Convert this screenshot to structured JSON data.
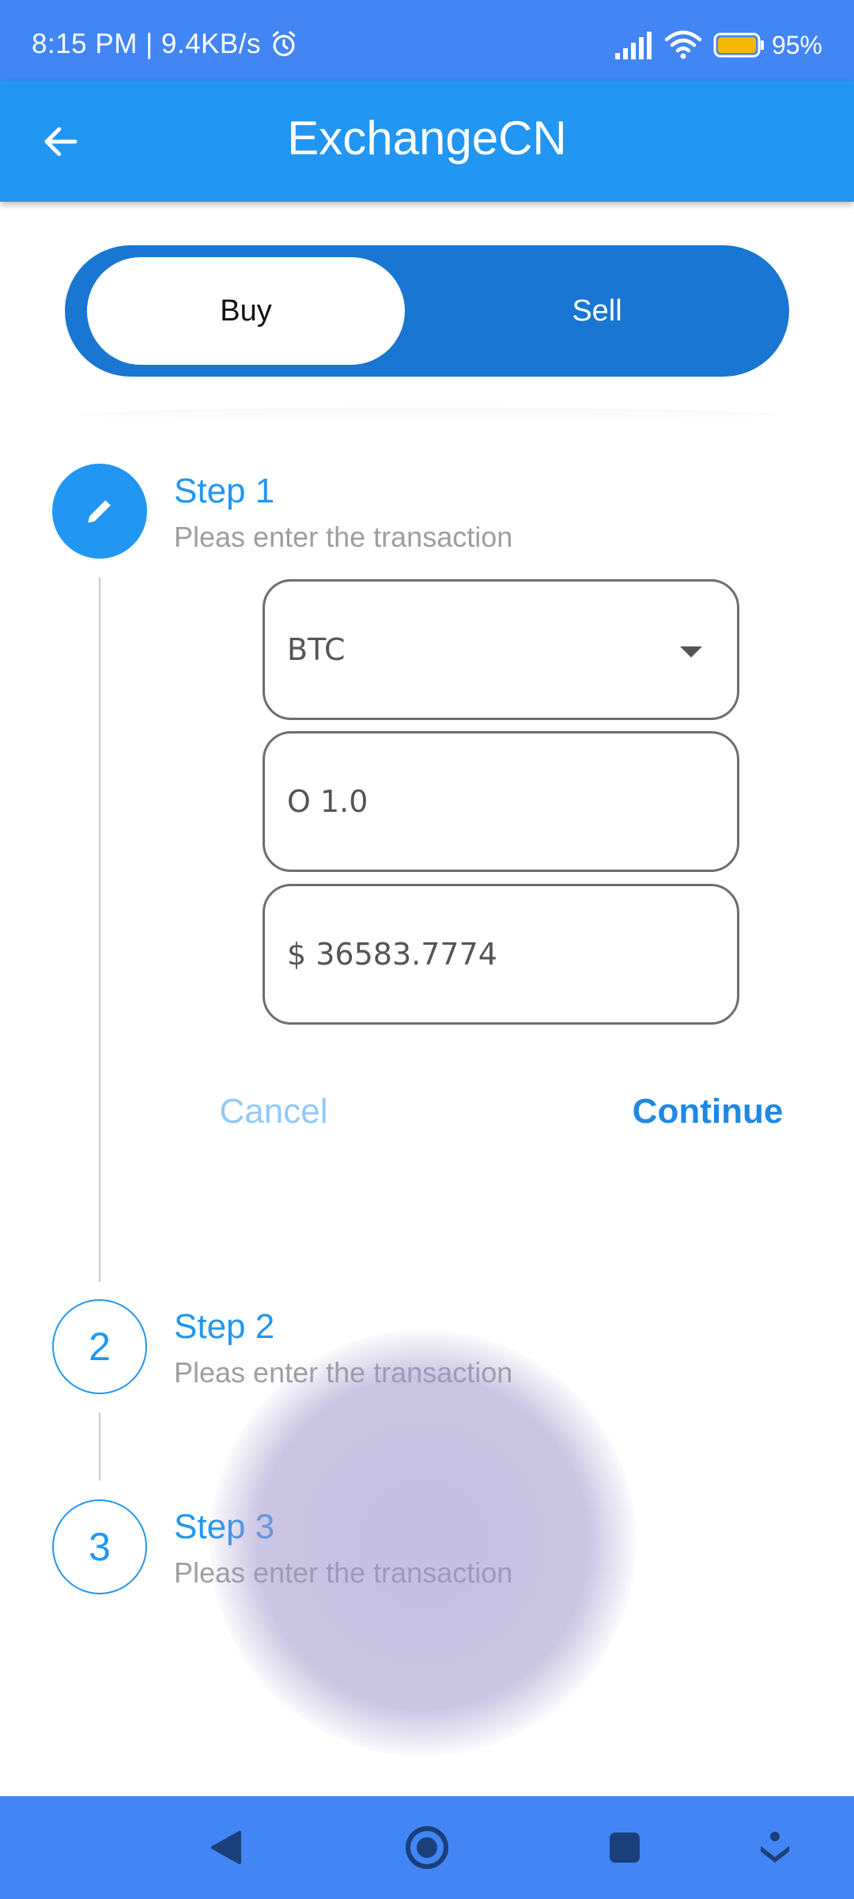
{
  "status_bar": {
    "time_speed": "8:15 PM | 9.4KB/s",
    "battery": "95%",
    "icons": [
      "alarm-icon",
      "signal-icon",
      "wifi-icon",
      "battery-icon"
    ]
  },
  "app_bar": {
    "title": "ExchangeCN",
    "back_icon": "arrow-left-icon"
  },
  "toggle": {
    "buy_label": "Buy",
    "sell_label": "Sell",
    "selected": "Buy"
  },
  "steps": [
    {
      "number": "1",
      "title": "Step 1",
      "subtitle": "Pleas enter the transaction",
      "state": "active",
      "icon": "edit-icon"
    },
    {
      "number": "2",
      "title": "Step 2",
      "subtitle": "Pleas enter the transaction",
      "state": "idle"
    },
    {
      "number": "3",
      "title": "Step 3",
      "subtitle": "Pleas enter the transaction",
      "state": "idle"
    }
  ],
  "form": {
    "currency": "BTC",
    "amount": "O 1.0",
    "price": "$ 36583.7774"
  },
  "actions": {
    "cancel_label": "Cancel",
    "continue_label": "Continue"
  },
  "nav_bar": {
    "icons": [
      "back-triangle-icon",
      "home-circle-icon",
      "recents-square-icon",
      "accessibility-icon"
    ]
  },
  "colors": {
    "status_bar": "#4285f4",
    "app_bar": "#2196f3",
    "toggle_bg": "#1976d2",
    "accent": "#2196f3",
    "cancel": "#90caf9",
    "continue": "#1e88e5"
  }
}
